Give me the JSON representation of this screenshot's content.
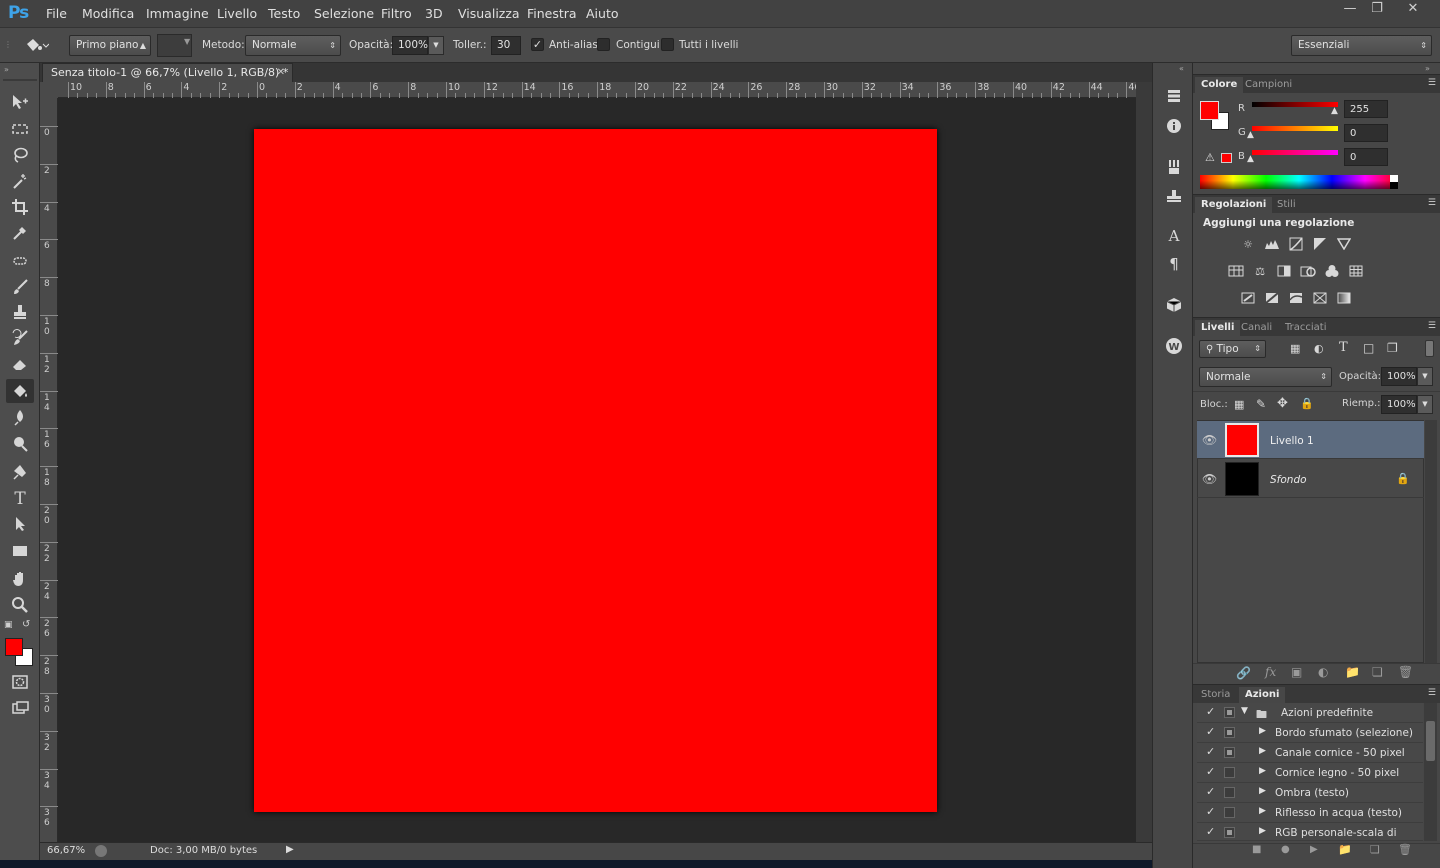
{
  "app": {
    "logo": "Ps"
  },
  "menubar": {
    "items": [
      "File",
      "Modifica",
      "Immagine",
      "Livello",
      "Testo",
      "Selezione",
      "Filtro",
      "3D",
      "Visualizza",
      "Finestra",
      "Aiuto"
    ]
  },
  "window_controls": [
    "minimize-icon",
    "restore-icon",
    "close-icon"
  ],
  "options": {
    "preset": "Primo piano",
    "method_label": "Metodo:",
    "method_value": "Normale",
    "opacity_label": "Opacità:",
    "opacity_value": "100%",
    "tolerance_label": "Toller.:",
    "tolerance_value": "30",
    "antialias_label": "Anti-alias",
    "antialias_checked": true,
    "contiguous_label": "Contigui",
    "contiguous_checked": false,
    "all_layers_label": "Tutti i livelli",
    "all_layers_checked": false,
    "workspace": "Essenziali"
  },
  "document": {
    "tab_title": "Senza titolo-1 @ 66,7% (Livello 1, RGB/8) *",
    "fill_color": "#ff0000",
    "zoom": "66,67%",
    "doc_info": "Doc: 3,00 MB/0 bytes"
  },
  "rulers": {
    "top_labels": [
      "10",
      "8",
      "6",
      "4",
      "2",
      "0",
      "2",
      "4",
      "6",
      "8",
      "10",
      "12",
      "14",
      "16",
      "18",
      "20",
      "22",
      "24",
      "26",
      "28",
      "30",
      "32",
      "34",
      "36",
      "38",
      "40",
      "42",
      "44",
      "46"
    ],
    "left_labels": [
      "0",
      "2",
      "4",
      "6",
      "8",
      "10",
      "12",
      "14",
      "16",
      "18",
      "20",
      "22",
      "24",
      "26",
      "28",
      "30",
      "32",
      "34",
      "36"
    ]
  },
  "toolbar": {
    "tools": [
      "move-icon",
      "marquee-icon",
      "lasso-icon",
      "magic-wand-icon",
      "crop-icon",
      "eyedropper-icon",
      "healing-brush-icon",
      "brush-icon",
      "clone-stamp-icon",
      "history-brush-icon",
      "eraser-icon",
      "paint-bucket-icon",
      "blur-icon",
      "dodge-icon",
      "pen-icon",
      "type-icon",
      "path-selection-icon",
      "rectangle-icon",
      "hand-icon",
      "zoom-icon"
    ],
    "active_tool": "paint-bucket-icon",
    "foreground_color": "#ff0000",
    "background_color": "#ffffff"
  },
  "color_panel": {
    "tabs": [
      "Colore",
      "Campioni"
    ],
    "r_label": "R",
    "r_value": "255",
    "g_label": "G",
    "g_value": "0",
    "b_label": "B",
    "b_value": "0"
  },
  "adjust_panel": {
    "tabs": [
      "Regolazioni",
      "Stili"
    ],
    "heading": "Aggiungi una regolazione"
  },
  "layers_panel": {
    "tabs": [
      "Livelli",
      "Canali",
      "Tracciati"
    ],
    "filter": "Tipo",
    "blend_mode": "Normale",
    "opacity_label": "Opacità:",
    "opacity_value": "100%",
    "lock_label": "Bloc.:",
    "fill_label": "Riemp.:",
    "fill_value": "100%",
    "layers": [
      {
        "name": "Livello 1",
        "color": "#ff0000",
        "selected": true
      },
      {
        "name": "Sfondo",
        "color": "#000000",
        "selected": false
      }
    ]
  },
  "actions_panel": {
    "tabs": [
      "Storia",
      "Azioni"
    ],
    "set_name": "Azioni predefinite",
    "actions": [
      "Bordo sfumato (selezione)",
      "Canale cornice - 50 pixel",
      "Cornice legno - 50 pixel",
      "Ombra (testo)",
      "Riflesso in acqua (testo)",
      "RGB personale-scala di grigio"
    ]
  }
}
